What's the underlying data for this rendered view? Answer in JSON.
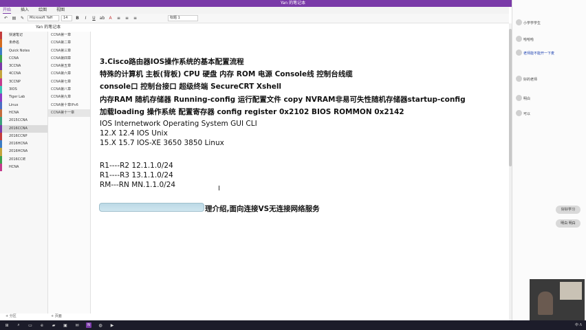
{
  "window": {
    "title": "Yan 的笔记本",
    "controls": [
      "—",
      "□",
      "✕"
    ]
  },
  "ribbon_tabs": [
    {
      "label": "开始",
      "active": true
    },
    {
      "label": "插入",
      "active": false
    },
    {
      "label": "绘图",
      "active": false
    },
    {
      "label": "视图",
      "active": false
    }
  ],
  "toolbar": {
    "font_name": "Microsoft YaH",
    "font_size": "14",
    "style_box": "标题 1",
    "icons": [
      "undo-icon",
      "clipboard-icon",
      "brush-icon"
    ],
    "format_glyphs": [
      "B",
      "I",
      "U",
      "ab",
      "A",
      "≡",
      "≡",
      "≡"
    ]
  },
  "notebook": {
    "label": "Yan 的笔记本"
  },
  "sections": [
    {
      "label": "快速笔记",
      "color": "#c43c3c"
    },
    {
      "label": "未命名",
      "color": "#d46b1f"
    },
    {
      "label": "Quick Notes",
      "color": "#3c7cc4"
    },
    {
      "label": "CCNA",
      "color": "#3ca04c"
    },
    {
      "label": "3CCNA",
      "color": "#7a3aa8"
    },
    {
      "label": "4CCNA",
      "color": "#c4a43c"
    },
    {
      "label": "3CCNP",
      "color": "#c43c8c"
    },
    {
      "label": "3IOS",
      "color": "#3cc4b4"
    },
    {
      "label": "Tiger Lab",
      "color": "#8c3cc4"
    },
    {
      "label": "Linux",
      "color": "#4c6cc4"
    },
    {
      "label": "HCNA",
      "color": "#c46c3c"
    },
    {
      "label": "2015CCNA",
      "color": "#3ca07c"
    },
    {
      "label": "2016CCNA",
      "color": "#7a3aa8",
      "selected": true
    },
    {
      "label": "2016CCNP",
      "color": "#c43c3c"
    },
    {
      "label": "2016HCNA",
      "color": "#3c7cc4"
    },
    {
      "label": "2016HCNA",
      "color": "#c4a43c"
    },
    {
      "label": "2016CCIE",
      "color": "#3ca04c"
    },
    {
      "label": "HCNA",
      "color": "#c43c8c"
    }
  ],
  "pages": [
    {
      "label": "CCNA第一章"
    },
    {
      "label": "CCNA第二章"
    },
    {
      "label": "CCNA第三章"
    },
    {
      "label": "CCNA第四章"
    },
    {
      "label": "CCNA第五章"
    },
    {
      "label": "CCNA第六章"
    },
    {
      "label": "CCNA第七章"
    },
    {
      "label": "CCNA第八章"
    },
    {
      "label": "CCNA第九章"
    },
    {
      "label": "CCNA第十章IPv6"
    },
    {
      "label": "CCNA第十一章",
      "selected": true
    }
  ],
  "bottom_bar": {
    "add_section": "+ 分区",
    "add_page": "+ 页面"
  },
  "content": {
    "lines": [
      {
        "text": "3.Cisco路由器IOS操作系统的基本配置流程",
        "bold": true
      },
      {
        "text": "特殊的计算机 主板(背板) CPU 硬盘 内存 ROM 电源   Console线 控制台线缆",
        "bold": true
      },
      {
        "text": "console口 控制台接口 超级终端  SecureCRT  Xshell",
        "bold": true
      },
      {
        "text": "内存RAM 随机存储器  Running-config 运行配置文件 copy NVRAM非易可失性随机存储器startup-config",
        "bold": true
      },
      {
        "text": "加载loading 操作系统 配置寄存器 config register 0x2102 BIOS ROMMON 0x2142",
        "bold": true
      },
      {
        "text": "IOS  Internetwork Operating System  GUI CLI",
        "bold": false
      },
      {
        "text": "12.X  12.4 IOS   Unix",
        "bold": false
      },
      {
        "text": "15.X  15.7 IOS-XE 3650 3850 Linux",
        "bold": false
      },
      {
        "text": "",
        "bold": false
      },
      {
        "text": "R1----R2  12.1.1.0/24",
        "bold": false
      },
      {
        "text": "R1----R3  13.1.1.0/24",
        "bold": false
      },
      {
        "text": "RM---RN  MN.1.1.0/24",
        "bold": false
      }
    ],
    "highlight_line_tail": "理介绍,面向连接VS无连接网络服务"
  },
  "right_panel": {
    "rows": [
      {
        "text": "小学学学生",
        "blue": false
      },
      {
        "text": "哈哈哈",
        "blue": false
      },
      {
        "text": "老师能不能开一下麦",
        "blue": true
      },
      {
        "text": "好的老师",
        "blue": false
      },
      {
        "text": "明白",
        "blue": false
      },
      {
        "text": "可以",
        "blue": false
      }
    ],
    "bubbles": [
      "好好学习",
      "明白 明白"
    ]
  },
  "taskbar": {
    "icons": [
      "windows-icon",
      "search-icon",
      "taskview-icon",
      "edge-icon",
      "folder-icon",
      "store-icon",
      "mail-icon",
      "onenote-icon",
      "chat-icon",
      "media-icon"
    ],
    "onenote_glyph": "N",
    "tray_text": "中 ᐱ"
  }
}
